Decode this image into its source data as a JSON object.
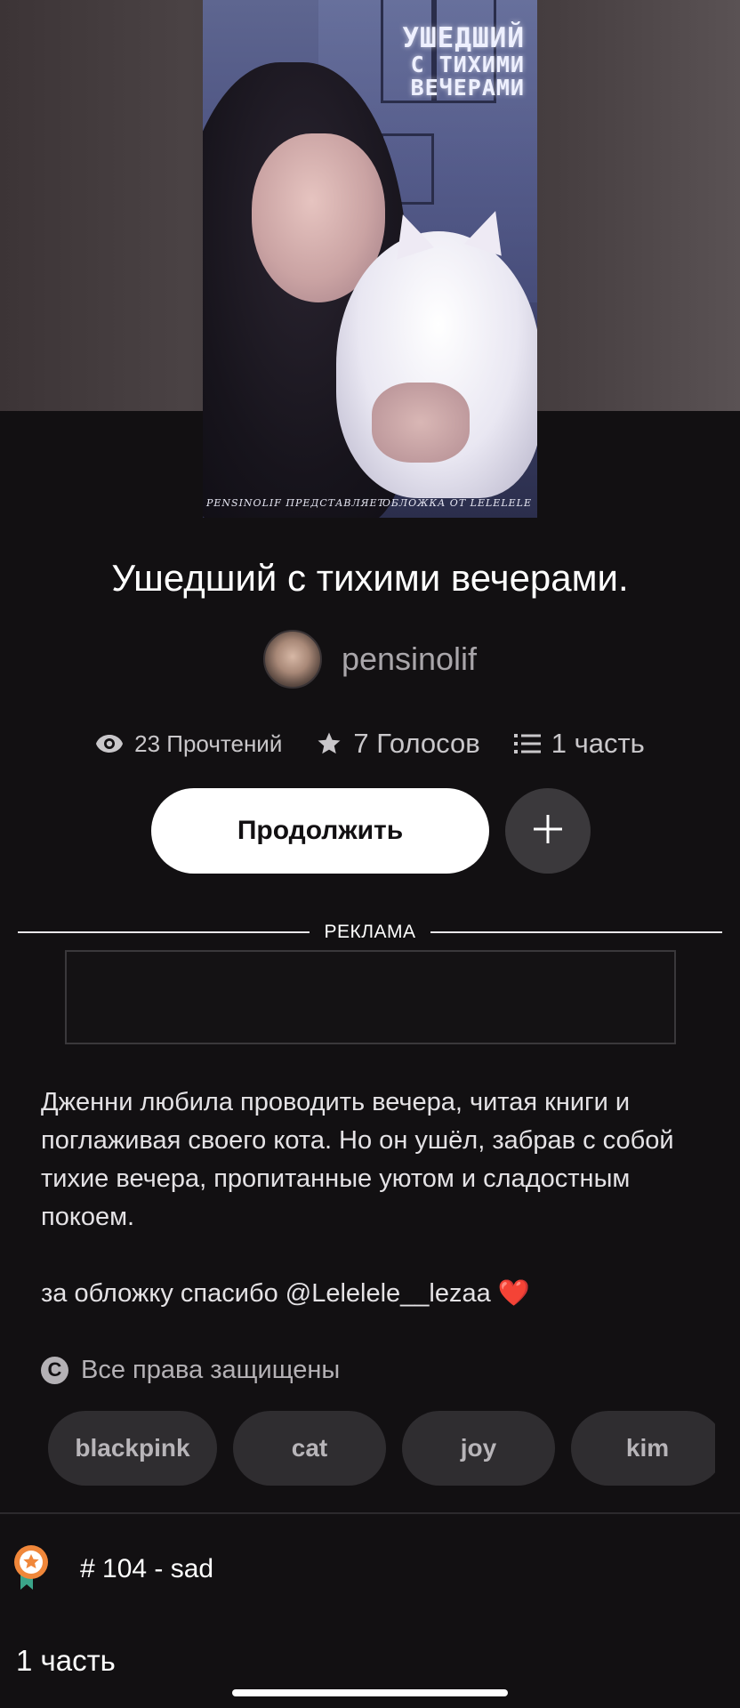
{
  "cover": {
    "title_line1": "УШЕДШИЙ",
    "title_line2": "С ТИХИМИ",
    "title_line3": "ВЕЧЕРАМИ",
    "credit_left": "PENSINOLIF ПРЕДСТАВЛЯЕТ",
    "credit_right": "ОБЛОЖКА ОТ LELELELE"
  },
  "story": {
    "title": "Ушедший с тихими вечерами.",
    "author": "pensinolif"
  },
  "stats": {
    "reads": "23 Прочтений",
    "votes": "7 Голосов",
    "parts": "1 часть"
  },
  "actions": {
    "continue_label": "Продолжить",
    "add_icon": "plus-icon"
  },
  "ad": {
    "label": "РЕКЛАМА"
  },
  "description": {
    "paragraph1": "Дженни любила проводить вечера, читая книги и поглаживая своего кота. Но он ушёл, забрав с собой тихие вечера, пропитанные уютом и сладостным покоем.",
    "paragraph2": "за обложку спасибо @Lelelele__lezaa",
    "heart": "❤️"
  },
  "copyright": {
    "icon": "copyright-icon",
    "text": "Все права защищены"
  },
  "tags": [
    "blackpink",
    "cat",
    "joy",
    "kim"
  ],
  "ranking": {
    "icon": "award-badge-icon",
    "text": "# 104 - sad"
  },
  "parts_section": {
    "heading": "1 часть"
  },
  "colors": {
    "background": "#121012",
    "tag_bg": "#2f2d30",
    "badge_orange": "#f0873a",
    "badge_ribbon": "#3ba58a"
  }
}
